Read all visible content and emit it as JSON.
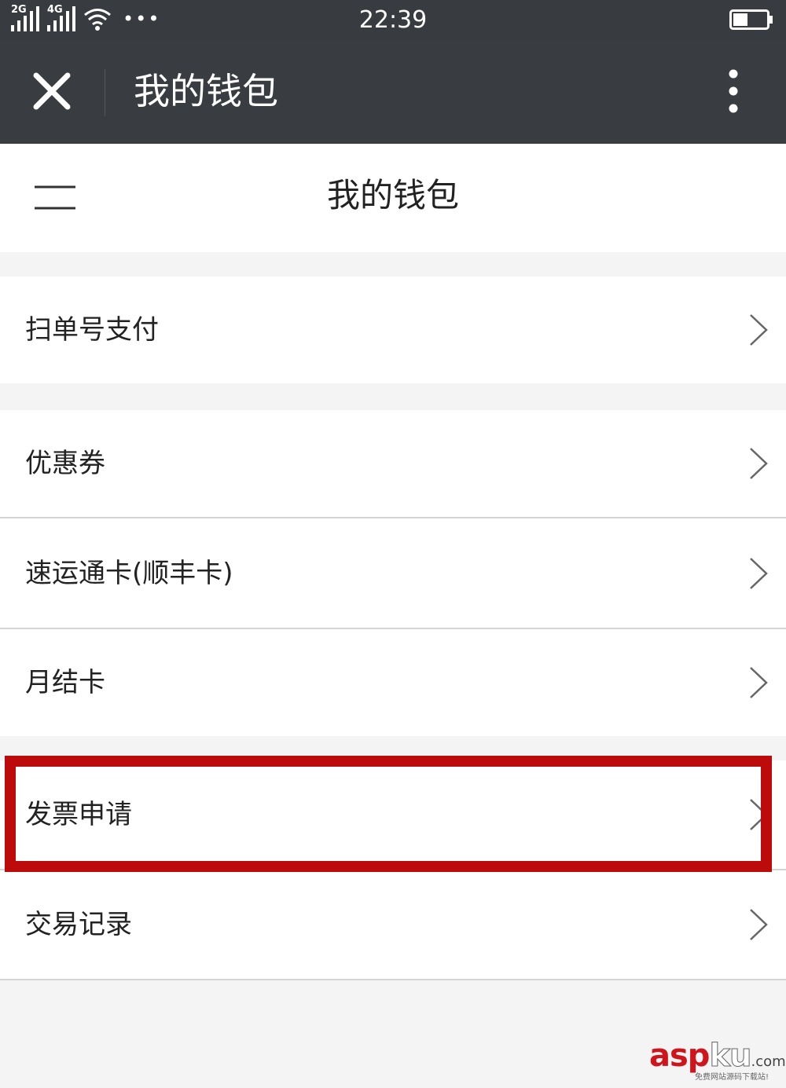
{
  "status_bar": {
    "net_1": "2G",
    "net_2": "4G",
    "time": "22:39",
    "more_dots": "•••"
  },
  "title_bar": {
    "title": "我的钱包"
  },
  "page_header": {
    "title": "我的钱包"
  },
  "menu": {
    "items": [
      {
        "label": "扫单号支付"
      },
      {
        "label": "优惠券"
      },
      {
        "label": "速运通卡(顺丰卡)"
      },
      {
        "label": "月结卡"
      },
      {
        "label": "发票申请"
      },
      {
        "label": "交易记录"
      }
    ]
  },
  "highlight": {
    "color": "#bd0b0b",
    "target": "发票申请"
  },
  "watermark": {
    "asp": "asp",
    "ku": "ku",
    "com": ".com",
    "sub": "免费网站源码下载站!"
  },
  "colors": {
    "title_bar": "#393d42",
    "page_bg": "#f4f4f4"
  }
}
